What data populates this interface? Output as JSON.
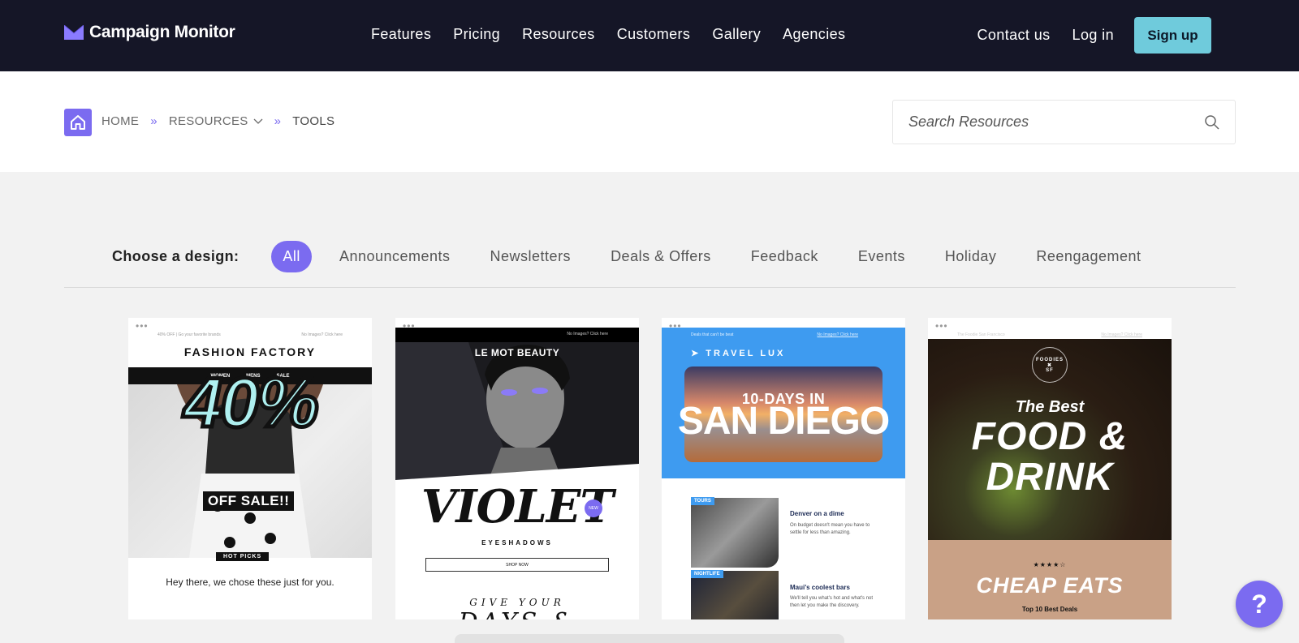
{
  "nav": {
    "logo": "Campaign Monitor",
    "links": [
      "Features",
      "Pricing",
      "Resources",
      "Customers",
      "Gallery",
      "Agencies"
    ],
    "contact": "Contact us",
    "login": "Log in",
    "signup": "Sign up"
  },
  "breadcrumb": {
    "home": "HOME",
    "sep": "»",
    "resources": "RESOURCES",
    "current": "TOOLS"
  },
  "search": {
    "placeholder": "Search Resources"
  },
  "filters": {
    "label": "Choose a design:",
    "options": [
      "All",
      "Announcements",
      "Newsletters",
      "Deals & Offers",
      "Feedback",
      "Events",
      "Holiday",
      "Reengagement"
    ],
    "selected": "All"
  },
  "cards": {
    "fashion": {
      "dots": "•••",
      "pre_left": "40% OFF | Go your favorite brands",
      "pre_right": "No Images? Click here",
      "brand": "FASHION FACTORY",
      "menu": [
        "WOMEN",
        "MENS",
        "SALE"
      ],
      "big": "40%",
      "off": "OFF SALE!!",
      "hot": "HOT PICKS",
      "copy": "Hey there, we chose these just for you."
    },
    "beauty": {
      "dots": "•••",
      "pre_right": "No Images? Click here",
      "brand": "LE MOT BEAUTY",
      "title": "VIOLET",
      "new": "NEW",
      "sub": "EYESHADOWS",
      "button": "SHOP NOW",
      "give": "GIVE YOUR",
      "days": "DAYS &"
    },
    "travel": {
      "dots": "•••",
      "pre_left": "Deals that can't be beat",
      "pre_right": "No Images? Click here",
      "brand": "TRAVEL LUX",
      "title1": "10-DAYS IN",
      "title2": "SAN DIEGO",
      "tag1": "TOURS",
      "head1": "Denver on a dime",
      "para1": "On budget doesn't mean you have to settle for less than amazing.",
      "tag2": "NIGHTLIFE",
      "head2": "Maui's coolest bars",
      "para2": "We'll tell you what's hot and what's not then let you make the discovery."
    },
    "foodies": {
      "dots": "•••",
      "pre_left": "The Foodie San Francisco",
      "pre_right": "No Images? Click here",
      "badge_top": "FOODIES",
      "badge_bottom": "SF",
      "best": "The Best",
      "food": "FOOD &",
      "drink": "DRINK",
      "stars": "★★★★☆",
      "cheap": "CHEAP EATS",
      "top": "Top 10 Best Deals"
    }
  },
  "help": {
    "label": "?"
  },
  "colors": {
    "accent": "#7b6bf0",
    "nav_bg": "#151627",
    "signup": "#6fcbdc"
  }
}
